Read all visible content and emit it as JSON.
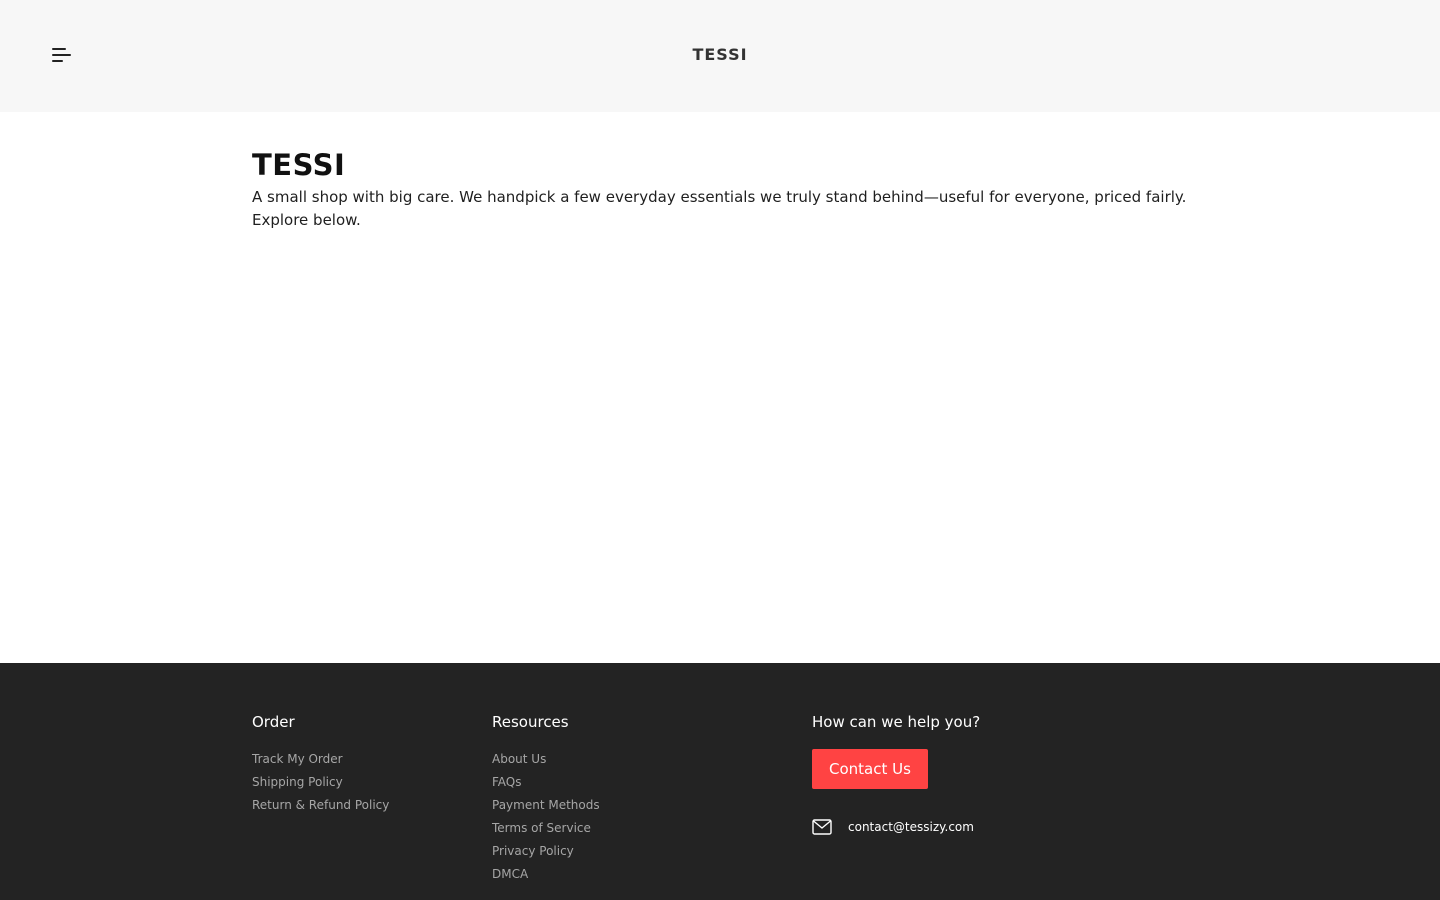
{
  "header": {
    "logo": "TESSI",
    "menu_icon": "menu-icon"
  },
  "main": {
    "title": "TESSI",
    "description": "A small shop with big care. We handpick a few everyday essentials we truly stand behind—useful for everyone, priced fairly. Explore below."
  },
  "footer": {
    "order": {
      "heading": "Order",
      "links": [
        "Track My Order",
        "Shipping Policy",
        "Return & Refund Policy"
      ]
    },
    "resources": {
      "heading": "Resources",
      "links": [
        "About Us",
        "FAQs",
        "Payment Methods",
        "Terms of Service",
        "Privacy Policy",
        "DMCA"
      ]
    },
    "help": {
      "heading": "How can we help you?",
      "button_label": "Contact Us",
      "email": "contact@tessizy.com",
      "email_icon": "mail-icon"
    }
  },
  "colors": {
    "header_bg": "#f7f7f7",
    "footer_bg": "#232323",
    "accent": "#ff4343"
  }
}
